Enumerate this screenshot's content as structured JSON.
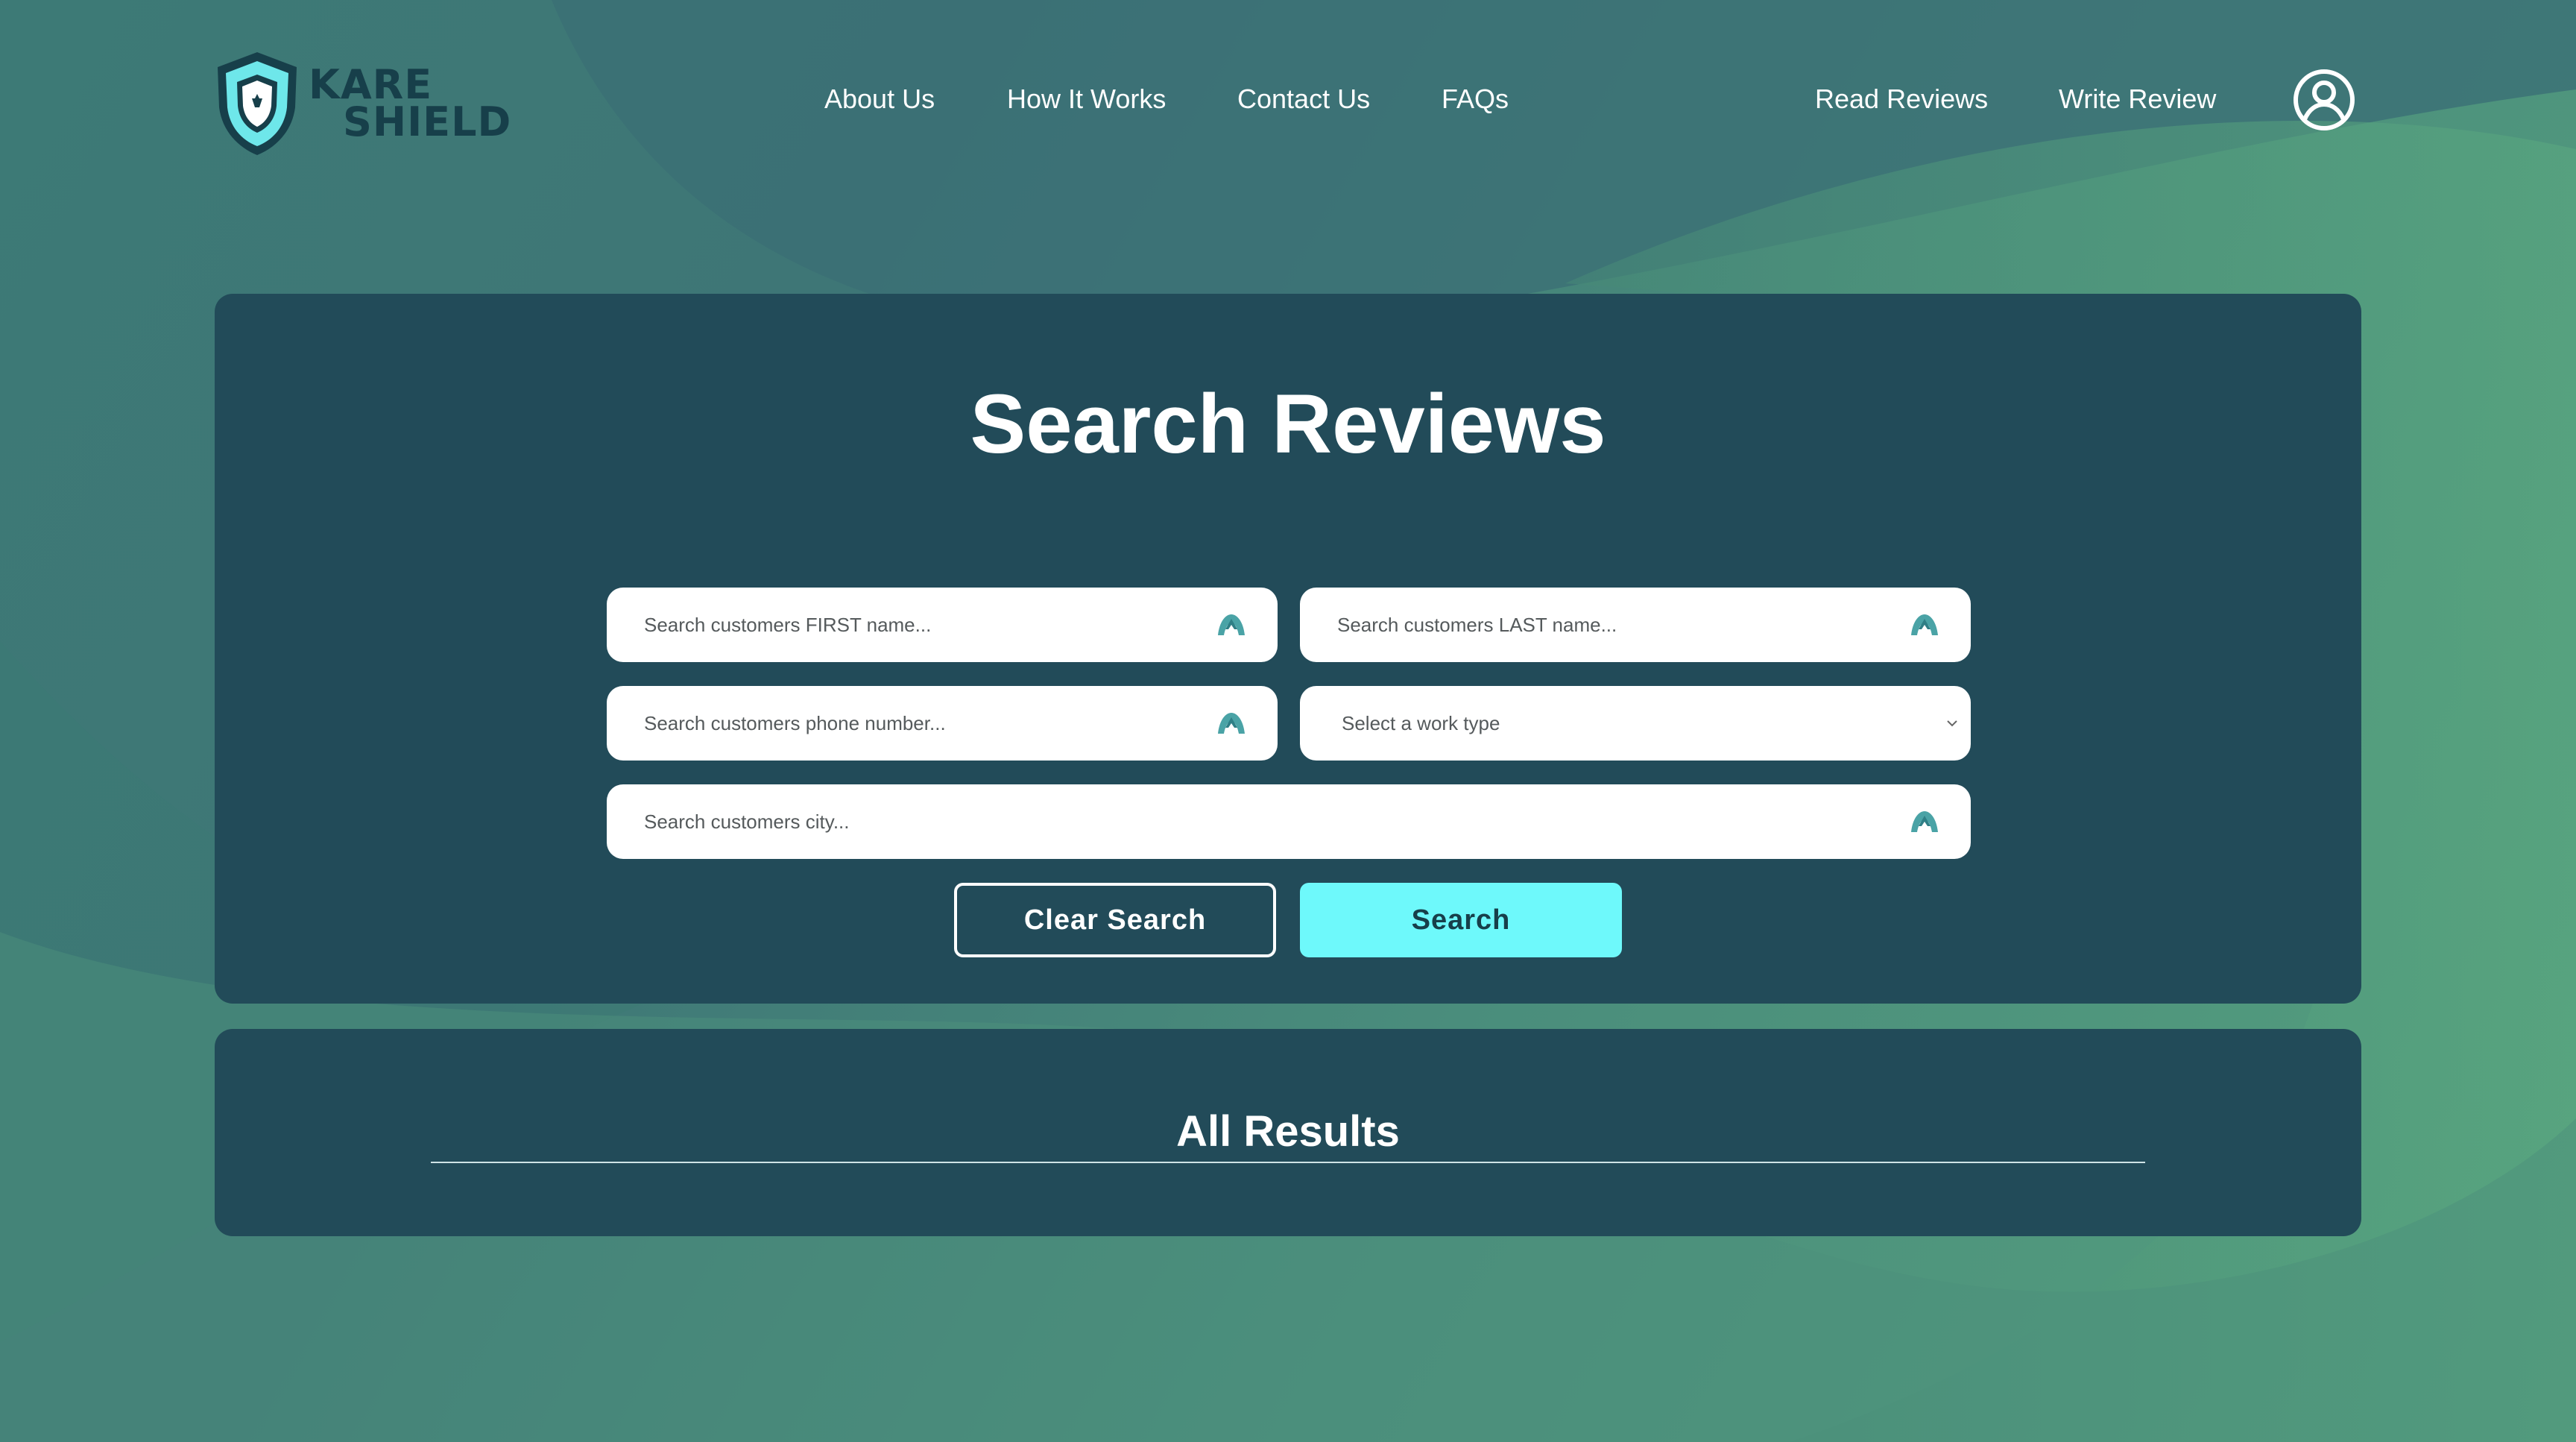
{
  "brand": {
    "line1": "KARE",
    "line2": "SHIELD"
  },
  "nav": {
    "about": "About Us",
    "how_it_works": "How It Works",
    "contact": "Contact Us",
    "faqs": "FAQs",
    "read_reviews": "Read Reviews",
    "write_review": "Write Review"
  },
  "icons": {
    "logo": "shield-logo-icon",
    "user": "user-account-icon",
    "field_search": "search-icon",
    "select_arrow": "chevron-down-icon"
  },
  "search": {
    "title": "Search Reviews",
    "first_name_placeholder": "Search customers FIRST name...",
    "last_name_placeholder": "Search customers LAST name...",
    "phone_placeholder": "Search customers phone number...",
    "work_type_selected": "Select a work type",
    "city_placeholder": "Search customers city...",
    "clear_label": "Clear Search",
    "search_label": "Search"
  },
  "results": {
    "title": "All Results"
  },
  "colors": {
    "panel": "#224b59",
    "accent": "#6ef9fb",
    "brand_dark": "#173f4a",
    "icon_teal": "#4aa3a6"
  }
}
